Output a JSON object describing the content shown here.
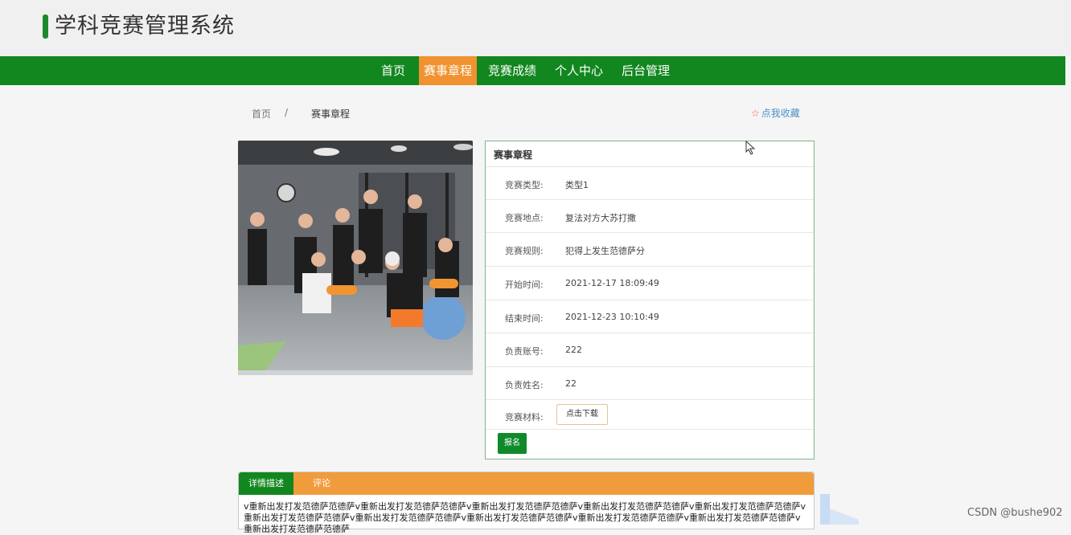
{
  "header": {
    "title": "学科竞赛管理系统"
  },
  "nav": {
    "items": [
      "首页",
      "赛事章程",
      "竞赛成绩",
      "个人中心",
      "后台管理"
    ],
    "active_index": 1
  },
  "breadcrumb": {
    "home": "首页",
    "separator": "/",
    "current": "赛事章程"
  },
  "favorite": {
    "label": "点我收藏"
  },
  "detail": {
    "title": "赛事章程",
    "fields": [
      {
        "label": "竞赛类型:",
        "value": "类型1"
      },
      {
        "label": "竞赛地点:",
        "value": "复法对方大苏打撒"
      },
      {
        "label": "竞赛规则:",
        "value": "犯得上发生范德萨分"
      },
      {
        "label": "开始时间:",
        "value": "2021-12-17 18:09:49"
      },
      {
        "label": "结束时间:",
        "value": "2021-12-23 10:10:49"
      },
      {
        "label": "负责账号:",
        "value": "222"
      },
      {
        "label": "负责姓名:",
        "value": "22"
      },
      {
        "label": "竞赛材料:",
        "value": ""
      }
    ],
    "download_label": "点击下载",
    "signup_label": "报名"
  },
  "tabs": {
    "items": [
      "详情描述",
      "评论"
    ],
    "active_index": 0,
    "content": "v重新出发打发范德萨范德萨v重新出发打发范德萨范德萨v重新出发打发范德萨范德萨v重新出发打发范德萨范德萨v重新出发打发范德萨范德萨v重新出发打发范德萨范德萨v重新出发打发范德萨范德萨v重新出发打发范德萨范德萨v重新出发打发范德萨范德萨v重新出发打发范德萨范德萨v重新出发打发范德萨范德萨"
  },
  "watermark": "CSDN @bushe902",
  "colors": {
    "primary": "#12871f",
    "accent": "#f0922f"
  }
}
